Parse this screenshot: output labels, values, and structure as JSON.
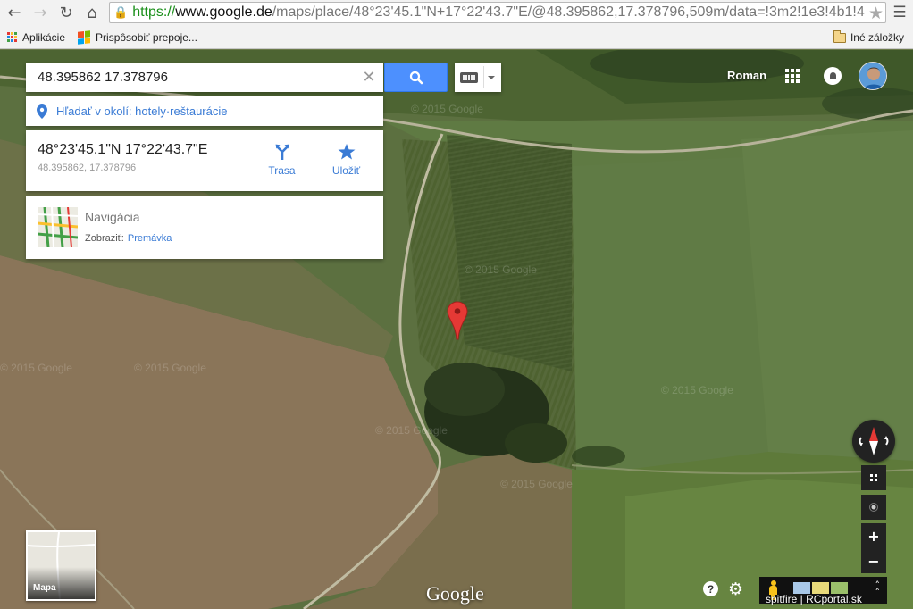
{
  "browser": {
    "url_scheme": "https://",
    "url_host": "www.google.de",
    "url_path": "/maps/place/48°23'45.1\"N+17°22'43.7\"E/@48.395862,17.378796,509m/data=!3m2!1e3!4b1!4",
    "bookmarks": [
      {
        "label": "Aplikácie",
        "icon": "apps-icon"
      },
      {
        "label": "Prispôsobiť prepoje...",
        "icon": "windows-icon"
      }
    ],
    "other_bookmarks": "Iné záložky"
  },
  "search": {
    "query": "48.395862 17.378796",
    "nearby_text": "Hľadať v okolí: hotely·reštaurácie"
  },
  "place": {
    "title": "48°23'45.1\"N 17°22'43.7\"E",
    "coords": "48.395862, 17.378796",
    "route_label": "Trasa",
    "save_label": "Uložiť"
  },
  "navigation": {
    "title": "Navigácia",
    "show_label": "Zobraziť:",
    "traffic_link": "Premávka"
  },
  "user": {
    "name": "Roman"
  },
  "map": {
    "minimap_label": "Mapa",
    "logo": "Google",
    "credit": "spitfire | RCportal.sk",
    "watermark": "© 2015 Google",
    "help": "?"
  },
  "colors": {
    "accent": "#4d90fe",
    "link": "#3a7bd5",
    "pin": "#e53935"
  }
}
